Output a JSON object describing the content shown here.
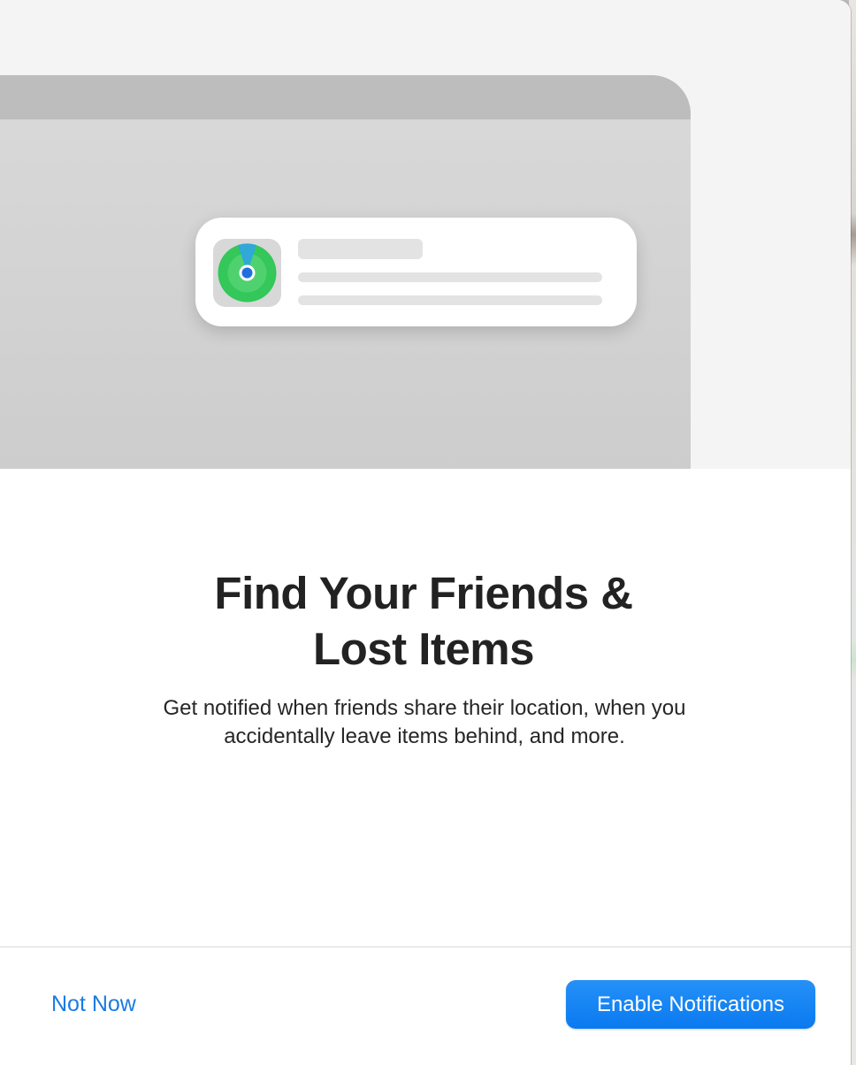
{
  "dialog": {
    "heading_line1": "Find Your Friends &",
    "heading_line2": "Lost Items",
    "subtitle_line1": "Get notified when friends share their location, when you",
    "subtitle_line2": "accidentally leave items behind, and more."
  },
  "illustration": {
    "app_icon": "find-my-icon",
    "icon_colors": {
      "outer": "#34c759",
      "inner": "#5cd679",
      "beam": "#30a8d8",
      "dot": "#1f6fe0"
    }
  },
  "footer": {
    "secondary_label": "Not Now",
    "primary_label": "Enable Notifications"
  },
  "colors": {
    "accent": "#0a7af0",
    "link": "#1a7be3"
  }
}
